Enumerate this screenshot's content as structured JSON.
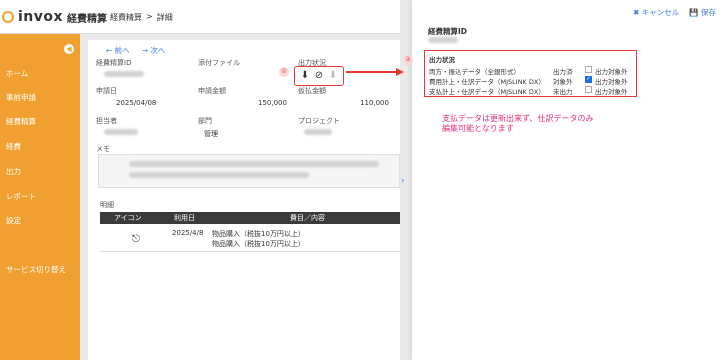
{
  "app": {
    "logo_text": "invox",
    "logo_sub": "経費精算"
  },
  "breadcrumb": {
    "part1": "経費精算",
    "sep": ">",
    "part2": "詳細"
  },
  "sidebar": {
    "items": [
      {
        "label": "ホーム"
      },
      {
        "label": "事前申請"
      },
      {
        "label": "経費精算"
      },
      {
        "label": "経費"
      },
      {
        "label": "出力"
      },
      {
        "label": "レポート"
      },
      {
        "label": "設定"
      },
      {
        "label": "サービス切り替え"
      }
    ],
    "collapse_icon": "chevron-left-icon"
  },
  "main": {
    "prev": "← 前へ",
    "next": "→ 次へ",
    "fields": {
      "id_label": "経費精算ID",
      "attach_label": "添付ファイル",
      "output_label": "出力状況",
      "date_label": "申請日",
      "date_value": "2025/04/08",
      "amount_label": "申請金額",
      "amount_value": "150,000",
      "advance_label": "仮払金額",
      "advance_value": "110,000",
      "person_label": "担当者",
      "dept_label": "部門",
      "dept_value": "管理",
      "project_label": "プロジェクト",
      "memo_label": "メモ"
    },
    "badge1": "①",
    "detail": {
      "title": "明細",
      "columns": [
        "アイコン",
        "利用日",
        "費目／内容"
      ],
      "rows": [
        {
          "date": "2025/4/8",
          "line1": "物品購入（税抜10万円以上）",
          "line2": "物品購入（税抜10万円以上）"
        }
      ]
    }
  },
  "drawer": {
    "cancel": "✖ キャンセル",
    "save": "保存",
    "id_label": "経費精算ID",
    "status_title": "出力状況",
    "rows": [
      {
        "name": "両方・振込データ（全銀形式）",
        "status": "出力済",
        "checked": false,
        "cb_label": "出力対象外"
      },
      {
        "name": "費用計上・仕訳データ（MJSLINK DX）",
        "status": "対象外",
        "checked": true,
        "cb_label": "出力対象外"
      },
      {
        "name": "支払計上・仕訳データ（MJSLINK DX）",
        "status": "未出力",
        "checked": false,
        "cb_label": "出力対象外"
      }
    ],
    "badge2": "②",
    "note_line1": "支払データは更新出来ず、仕訳データのみ",
    "note_line2": "編集可能となります"
  },
  "colors": {
    "accent": "#f0a030",
    "link": "#3a7bd5",
    "alert": "#e53935",
    "note": "#e0317a"
  }
}
